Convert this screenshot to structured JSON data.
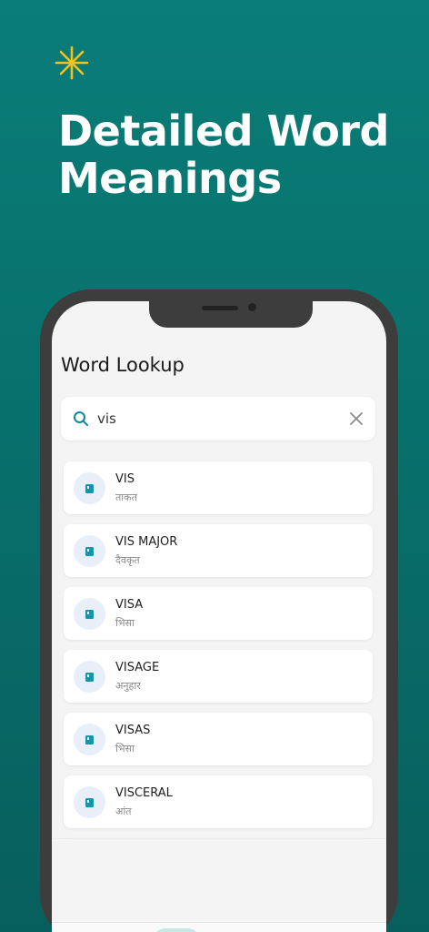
{
  "promo": {
    "headline_line1": "Detailed Word",
    "headline_line2": "Meanings",
    "accent_color": "#f2c21b"
  },
  "screen": {
    "title": "Word Lookup",
    "search": {
      "value": "vis",
      "placeholder": ""
    },
    "results": [
      {
        "word": "VIS",
        "meaning": "ताकत"
      },
      {
        "word": "VIS MAJOR",
        "meaning": "दैवकृत"
      },
      {
        "word": "VISA",
        "meaning": "भिसा"
      },
      {
        "word": "VISAGE",
        "meaning": "अनुहार"
      },
      {
        "word": "VISAS",
        "meaning": "भिसा"
      },
      {
        "word": "VISCERAL",
        "meaning": "आंत"
      }
    ],
    "nav": {
      "items": [
        "dashboard-icon",
        "globe-icon",
        "person-icon",
        "flower-icon"
      ],
      "active_index": 1
    }
  },
  "colors": {
    "background": "#0a7d78",
    "brand_teal": "#0e8a93"
  }
}
